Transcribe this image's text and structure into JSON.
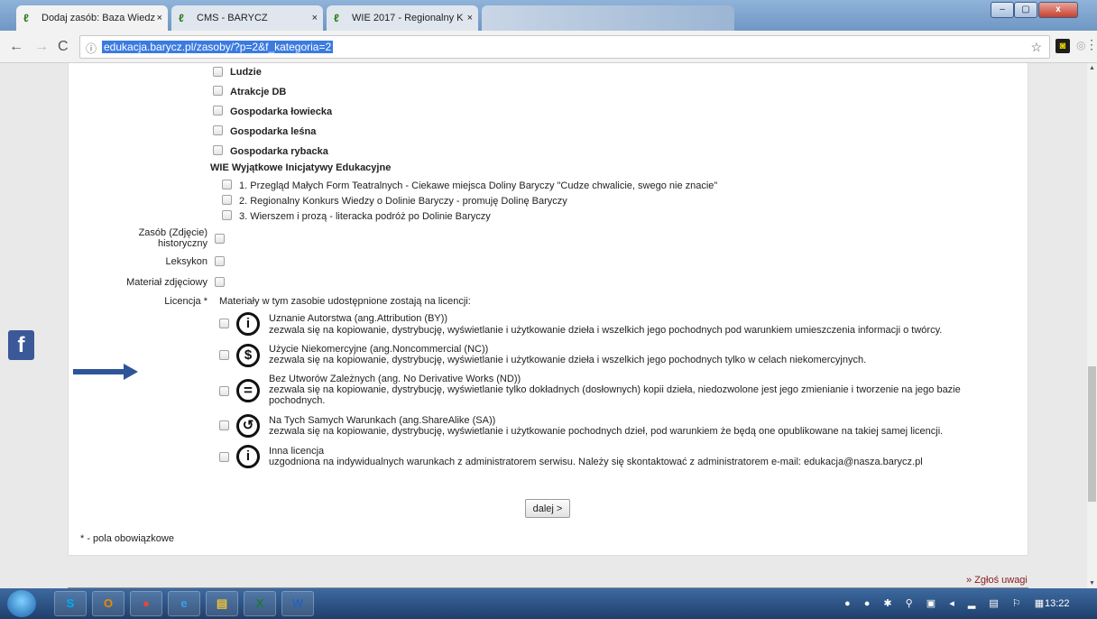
{
  "browser": {
    "tabs": [
      {
        "label": "Dodaj zasób: Baza Wiedz",
        "close": "×"
      },
      {
        "label": "CMS - BARYCZ",
        "close": "×"
      },
      {
        "label": "WIE 2017 - Regionalny K",
        "close": "×"
      }
    ],
    "favicon_glyph": "ℓ",
    "url": "edukacja.barycz.pl/zasoby/?p=2&f_kategoria=2",
    "window_controls": {
      "minimize": "–",
      "maximize": "▢",
      "close": "x"
    }
  },
  "form": {
    "category_items": [
      "Ludzie",
      "Atrakcje DB",
      "Gospodarka łowiecka",
      "Gospodarka leśna",
      "Gospodarka rybacka"
    ],
    "wie_heading": "WIE Wyjątkowe Inicjatywy Edukacyjne",
    "wie_items": [
      "1. Przegląd Małych Form Teatralnych - Ciekawe miejsca Doliny Baryczy \"Cudze chwalicie, swego nie znacie\"",
      "2. Regionalny Konkurs Wiedzy o Dolinie Baryczy - promuję Dolinę Baryczy",
      "3. Wierszem i prozą - literacka podróż po Dolinie Baryczy"
    ],
    "fields": {
      "zasob_zdjecie_line1": "Zasób (Zdjęcie)",
      "zasob_zdjecie_line2": "historyczny",
      "leksykon": "Leksykon",
      "material_zdjeciowy": "Materiał zdjęciowy",
      "licencja": "Licencja *"
    },
    "license_intro": "Materiały w tym zasobie udostępnione zostają na licencji:",
    "licenses": [
      {
        "icon": "attribution-icon",
        "glyph": "i",
        "title": "Uznanie Autorstwa (ang.Attribution (BY))",
        "desc": "zezwala się na kopiowanie, dystrybucję, wyświetlanie i użytkowanie dzieła i wszelkich jego pochodnych pod warunkiem umieszczenia informacji o twórcy."
      },
      {
        "icon": "noncommercial-icon",
        "glyph": "$",
        "title": "Użycie Niekomercyjne (ang.Noncommercial (NC))",
        "desc": "zezwala się na kopiowanie, dystrybucję, wyświetlanie i użytkowanie dzieła i wszelkich jego pochodnych tylko w celach niekomercyjnych."
      },
      {
        "icon": "no-derivatives-icon",
        "glyph": "=",
        "title": "Bez Utworów Zależnych (ang. No Derivative Works (ND))",
        "desc": "zezwala się na kopiowanie, dystrybucję, wyświetlanie tylko dokładnych (dosłownych) kopii dzieła, niedozwolone jest jego zmienianie i tworzenie na jego bazie pochodnych."
      },
      {
        "icon": "share-alike-icon",
        "glyph": "↺",
        "title": "Na Tych Samych Warunkach (ang.ShareAlike (SA))",
        "desc": "zezwala się na kopiowanie, dystrybucję, wyświetlanie i użytkowanie pochodnych dzieł, pod warunkiem że będą one opublikowane na takiej samej licencji."
      },
      {
        "icon": "other-license-icon",
        "glyph": "i",
        "title": "Inna licencja",
        "desc": "uzgodniona na indywidualnych warunkach z administratorem serwisu. Należy się skontaktować z administratorem e-mail: edukacja@nasza.barycz.pl"
      }
    ],
    "next_button": "dalej >",
    "required_note": "* - pola obowiązkowe",
    "report_link": "» Zgłoś uwagi"
  },
  "social": {
    "facebook_glyph": "f"
  },
  "taskbar": {
    "apps": [
      {
        "name": "skype-icon",
        "glyph": "S",
        "color": "#00aff0"
      },
      {
        "name": "outlook-icon",
        "glyph": "O",
        "color": "#e88b00"
      },
      {
        "name": "chrome-icon",
        "glyph": "●",
        "color": "#e04a3a"
      },
      {
        "name": "ie-icon",
        "glyph": "e",
        "color": "#3aa0e8"
      },
      {
        "name": "explorer-icon",
        "glyph": "▤",
        "color": "#e8c23a"
      },
      {
        "name": "excel-icon",
        "glyph": "X",
        "color": "#1d7a3a"
      },
      {
        "name": "word-icon",
        "glyph": "W",
        "color": "#2b5fb8"
      }
    ],
    "tray_glyphs": "● ● ✱ ⚲ ▣ ◂ ▂ ▤ ⚐ ▦",
    "clock": "13:22"
  }
}
